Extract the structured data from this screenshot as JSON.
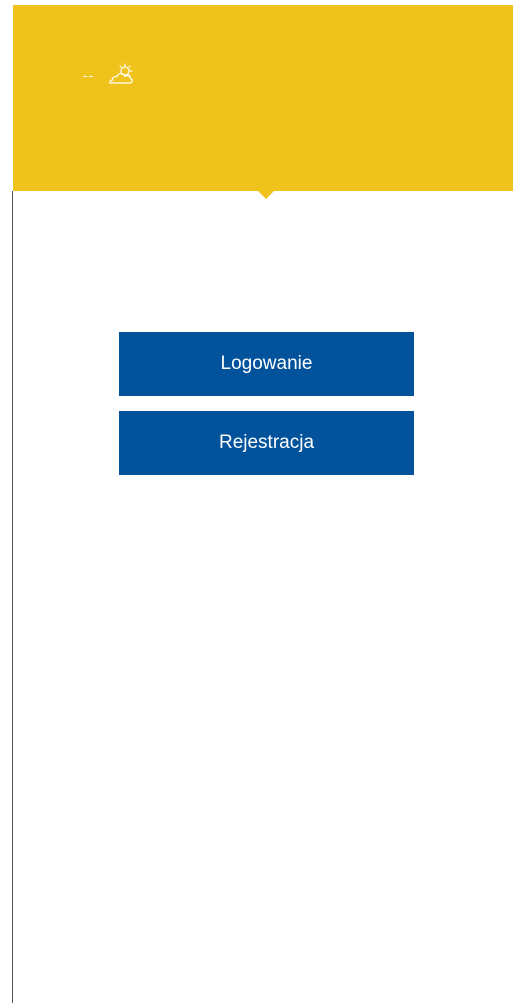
{
  "header": {
    "temperature": "--",
    "weather_icon": "partly-cloudy-icon",
    "background_color": "#f0c21c"
  },
  "actions": {
    "login_label": "Logowanie",
    "register_label": "Rejestracja",
    "button_color": "#02539c"
  }
}
